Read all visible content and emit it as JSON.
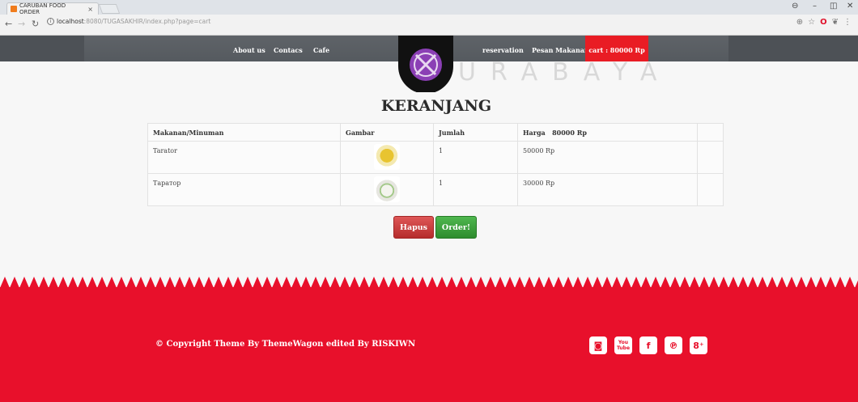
{
  "browser": {
    "tab_title": "CARUBAN FOOD ORDER",
    "tab_close": "×",
    "url_host": "localhost",
    "url_path": ":8080/TUGASAKHIR/index.php?page=cart"
  },
  "nav": {
    "left_links": [
      "About us",
      "Contacs",
      "Cafe"
    ],
    "right_links": [
      "reservation",
      "Pesan Makanan"
    ],
    "cart_label": "cart : 80000 Rp"
  },
  "watermark": "URABAYA",
  "page": {
    "title": "KERANJANG"
  },
  "cart_table": {
    "headers": [
      "Makanan/Minuman",
      "Gambar",
      "Jumlah",
      "Harga   80000 Rp",
      ""
    ],
    "rows": [
      {
        "name": "Tarator",
        "qty": "1",
        "price": "50000 Rp",
        "image": "bowl-yellow-soup"
      },
      {
        "name": "Таратор",
        "qty": "1",
        "price": "30000 Rp",
        "image": "bowl-white-soup"
      }
    ]
  },
  "buttons": {
    "delete": "Hapus",
    "order": "Order!"
  },
  "footer": {
    "copyright": "© Copyright Theme By ThemeWagon edited By RISKIWN",
    "socials": [
      "instagram-icon",
      "youtube-icon",
      "facebook-icon",
      "pinterest-icon",
      "google-plus-icon"
    ]
  },
  "colors": {
    "accent": "#e8102b",
    "navbar": "#4d5156",
    "hapus": "#c93c3c",
    "order": "#3da33d"
  }
}
